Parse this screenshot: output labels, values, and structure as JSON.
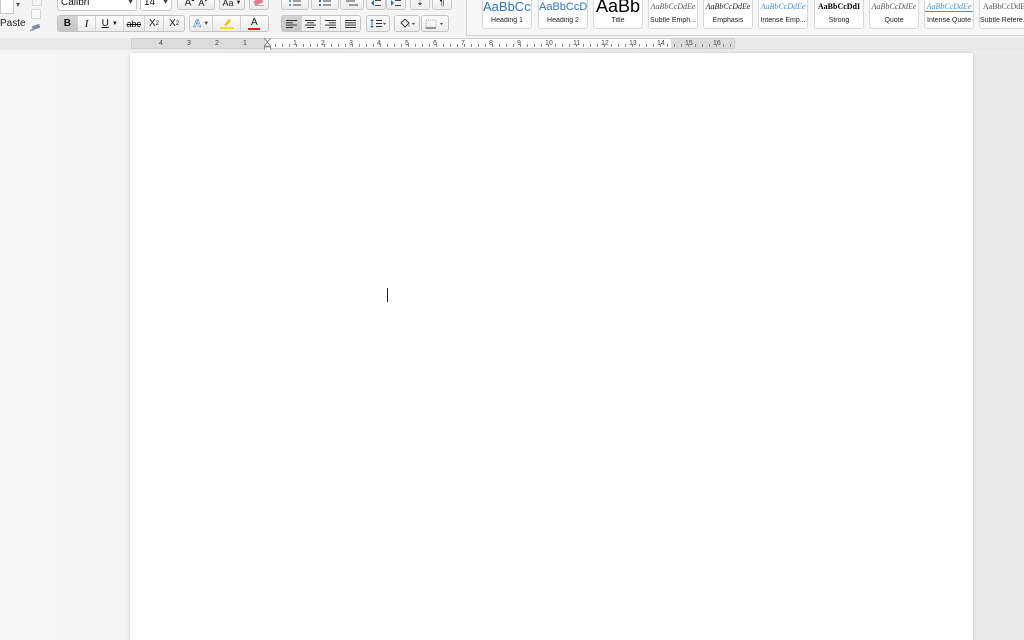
{
  "clipboard": {
    "paste_label": "Paste",
    "icons": [
      "paste-icon",
      "cut-icon",
      "copy-icon",
      "format-painter-icon"
    ]
  },
  "font": {
    "family": "Calibri",
    "size": "14"
  },
  "font_buttons": {
    "bold": "B",
    "italic": "I",
    "underline": "U",
    "strikethrough": "abc",
    "grow_font": "A",
    "shrink_font": "A",
    "change_case": "Aa",
    "font_color": "A",
    "text_effects": "A"
  },
  "paragraph": {
    "sort": "⇣",
    "show_marks": "¶",
    "active_alignment": "align-left"
  },
  "styles": [
    {
      "sample": "AaBbCcI",
      "name": "Heading 1",
      "color": "#2e74b5"
    },
    {
      "sample": "AaBbCcDd",
      "name": "Heading 2",
      "color": "#2e74b5"
    },
    {
      "sample": "AaBb",
      "name": "Title",
      "color": "#000000"
    },
    {
      "sample": "AaBbCcDdEe",
      "name": "Subtle Emph...",
      "color": "#555555"
    },
    {
      "sample": "AaBbCcDdEe",
      "name": "Emphasis",
      "color": "#222222"
    },
    {
      "sample": "AaBbCcDdEe",
      "name": "Intense Emp...",
      "color": "#4a90c8"
    },
    {
      "sample": "AaBbCcDdI",
      "name": "Strong",
      "color": "#000000"
    },
    {
      "sample": "AaBbCcDdEe",
      "name": "Quote",
      "color": "#555555"
    },
    {
      "sample": "AaBbCcDdEe",
      "name": "Intense Quote",
      "color": "#4a90c8"
    },
    {
      "sample": "AaBbCcDdE",
      "name": "Subtle Refere...",
      "color": "#555555"
    }
  ],
  "ruler": {
    "left_numbers": [
      "4",
      "3",
      "2",
      "1"
    ],
    "right_numbers": [
      "1",
      "2",
      "3",
      "4",
      "5",
      "6",
      "7",
      "8",
      "9",
      "10",
      "11",
      "12",
      "13",
      "14",
      "15",
      "16"
    ]
  },
  "colors": {
    "highlight": "#f5e200",
    "font_color_bar": "#e0201a",
    "accent": "#2e74b5"
  }
}
